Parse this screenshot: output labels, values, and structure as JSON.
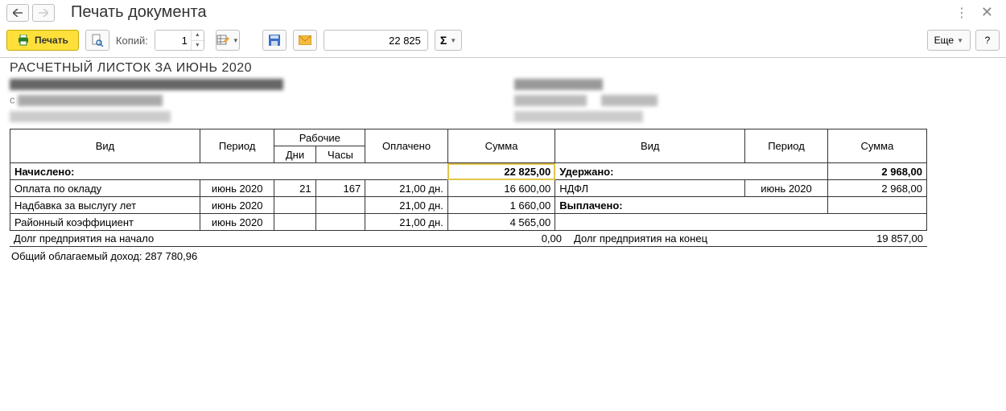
{
  "window_title": "Печать документа",
  "toolbar": {
    "print_label": "Печать",
    "copies_label": "Копий:",
    "copies_value": "1",
    "cell_value": "22 825",
    "more_label": "Еще",
    "help_label": "?"
  },
  "doc": {
    "title": "РАСЧЕТНЫЙ ЛИСТОК ЗА ИЮНЬ 2020",
    "headers": {
      "vid": "Вид",
      "period": "Период",
      "workers": "Рабочие",
      "days": "Дни",
      "hours": "Часы",
      "paid": "Оплачено",
      "sum": "Сумма"
    },
    "accrued": {
      "label": "Начислено:",
      "total": "22 825,00",
      "rows": [
        {
          "name": "Оплата по окладу",
          "period": "июнь 2020",
          "days": "21",
          "hours": "167",
          "paid": "21,00 дн.",
          "sum": "16 600,00"
        },
        {
          "name": "Надбавка за выслугу лет",
          "period": "июнь 2020",
          "days": "",
          "hours": "",
          "paid": "21,00 дн.",
          "sum": "1 660,00"
        },
        {
          "name": "Районный коэффициент",
          "period": "июнь 2020",
          "days": "",
          "hours": "",
          "paid": "21,00 дн.",
          "sum": "4 565,00"
        }
      ]
    },
    "withheld": {
      "label": "Удержано:",
      "total": "2 968,00",
      "rows": [
        {
          "name": "НДФЛ",
          "period": "июнь 2020",
          "sum": "2 968,00"
        }
      ]
    },
    "paidout": {
      "label": "Выплачено:"
    },
    "debt_start": {
      "label": "Долг предприятия на начало",
      "value": "0,00"
    },
    "debt_end": {
      "label": "Долг предприятия на конец",
      "value": "19 857,00"
    },
    "taxable": {
      "label": "Общий облагаемый доход:",
      "value": "287 780,96"
    }
  }
}
